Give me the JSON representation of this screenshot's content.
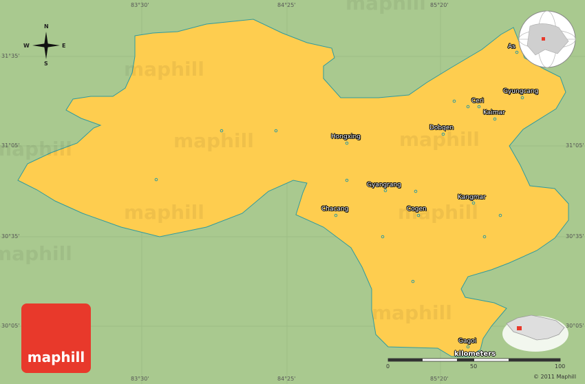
{
  "brand": {
    "logo_text": "maphill",
    "watermark": "maphill",
    "copyright": "© 2011 Maphill"
  },
  "compass": {
    "n": "N",
    "s": "S",
    "e": "E",
    "w": "W"
  },
  "coordinates": {
    "lon_top": [
      "83°30'",
      "84°25'",
      "85°20'"
    ],
    "lon_bottom": [
      "83°30'",
      "84°25'",
      "85°20'"
    ],
    "lat_left": [
      "31°35'",
      "31°05'",
      "30°35'",
      "30°05'"
    ],
    "lat_right": [
      "31°35'",
      "31°05'",
      "30°35'",
      "30°05'"
    ]
  },
  "places": [
    {
      "id": "as",
      "label": "As"
    },
    {
      "id": "gyungcang",
      "label": "Gyungcang"
    },
    {
      "id": "ceri",
      "label": "Ceri"
    },
    {
      "id": "kaimar",
      "label": "Kaimar"
    },
    {
      "id": "dobqen",
      "label": "Dobqen"
    },
    {
      "id": "hongxing",
      "label": "Hongxing"
    },
    {
      "id": "gyangrang",
      "label": "Gyangrang"
    },
    {
      "id": "kangmar",
      "label": "Kangmar"
    },
    {
      "id": "chacang",
      "label": "Chacang"
    },
    {
      "id": "cogen",
      "label": "Cogen"
    },
    {
      "id": "gagoi",
      "label": "Gagoi"
    }
  ],
  "scale": {
    "unit_label": "kilometers",
    "ticks": [
      "0",
      "50",
      "100"
    ]
  },
  "colors": {
    "land": "#a9c98f",
    "region": "#fecd4f",
    "border": "#2f9a9e",
    "brand": "#e8392b"
  }
}
